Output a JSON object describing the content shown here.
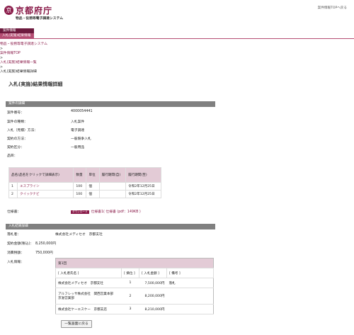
{
  "header": {
    "logo_mark": "京",
    "logo_text": "京都府庁",
    "subtitle": "物品・役務等電子調達システム",
    "top_link": "案件情報TOPへ戻る"
  },
  "nav": {
    "item1": "案件情報",
    "item2": "入札(実施)結果情報"
  },
  "breadcrumb": {
    "c1": "物品・役務等電子調達システム",
    "sep": ">",
    "c2": "案件情報TOP",
    "c3": "入札(実施)結果情報一覧",
    "c4": "入札(実施)結果情報詳細"
  },
  "page_title": "入札(実施)結果情報詳細",
  "case_section": {
    "title": "案件の詳細",
    "fields": [
      {
        "label": "案件番号：",
        "value": "4000054441"
      },
      {
        "label": "案件の種類：",
        "value": "入札案件"
      },
      {
        "label": "入札（見積）方法：",
        "value": "電子調達"
      },
      {
        "label": "契約の方法：",
        "value": "一般競争入札"
      },
      {
        "label": "契約区分：",
        "value": "一般用品"
      },
      {
        "label": "品目：",
        "value": ""
      }
    ],
    "items_table": {
      "headers": [
        "品名(品名をクリックで詳細表示)",
        "数量",
        "単位",
        "履行期間(自)",
        "履行期間(至)"
      ],
      "rows": [
        {
          "no": "1",
          "name": "エスプライン",
          "qty": "100",
          "unit": "個",
          "from": "",
          "to": "令和2年12月25日"
        },
        {
          "no": "2",
          "name": "クイックナビ",
          "qty": "100",
          "unit": "個",
          "from": "",
          "to": "令和2年12月25日"
        }
      ]
    },
    "spec_label": "仕様書：",
    "spec_badge": "ダウンロード",
    "spec_link": "仕様書1( 仕様書 (pdf：149KB )"
  },
  "result_section": {
    "title": "入札結果詳細",
    "fields": [
      {
        "label": "落札者：",
        "value": "株式会社メディセオ　京都支社"
      },
      {
        "label": "契約金額(税込)：",
        "value": "8,250,000円"
      },
      {
        "label": "消費税額：",
        "value": "750,000円"
      },
      {
        "label": "入札情報：",
        "value": ""
      }
    ],
    "bids": {
      "round": "第1回",
      "headers": [
        "[ 入札者氏名 ]",
        "[ 摘位 ]",
        "[ 入札金額 ]",
        "[ 備考 ]"
      ],
      "rows": [
        {
          "name": "株式会社メディセオ　京都支社",
          "rank": "1",
          "amount": "7,500,000円",
          "note": "落札"
        },
        {
          "name": "アルフレッサ株式会社　関西営業本部　京滋営業部",
          "rank": "2",
          "amount": "8,200,000円",
          "note": ""
        },
        {
          "name": "株式会社ケーエスケー　京都支店",
          "rank": "3",
          "amount": "8,210,000円",
          "note": ""
        }
      ]
    }
  },
  "back_button": "一覧画面に戻る"
}
